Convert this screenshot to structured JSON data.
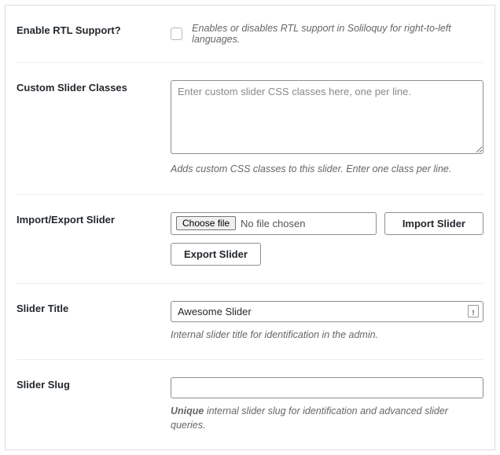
{
  "rows": {
    "rtl": {
      "label": "Enable RTL Support?",
      "helper": "Enables or disables RTL support in Soliloquy for right-to-left languages."
    },
    "classes": {
      "label": "Custom Slider Classes",
      "placeholder": "Enter custom slider CSS classes here, one per line.",
      "helper": "Adds custom CSS classes to this slider. Enter one class per line."
    },
    "importexport": {
      "label": "Import/Export Slider",
      "choose_label": "Choose file",
      "file_status": "No file chosen",
      "import_label": "Import Slider",
      "export_label": "Export Slider"
    },
    "title": {
      "label": "Slider Title",
      "value": "Awesome Slider",
      "helper": "Internal slider title for identification in the admin."
    },
    "slug": {
      "label": "Slider Slug",
      "value": "",
      "helper_bold": "Unique",
      "helper_rest": " internal slider slug for identification and advanced slider queries."
    }
  }
}
